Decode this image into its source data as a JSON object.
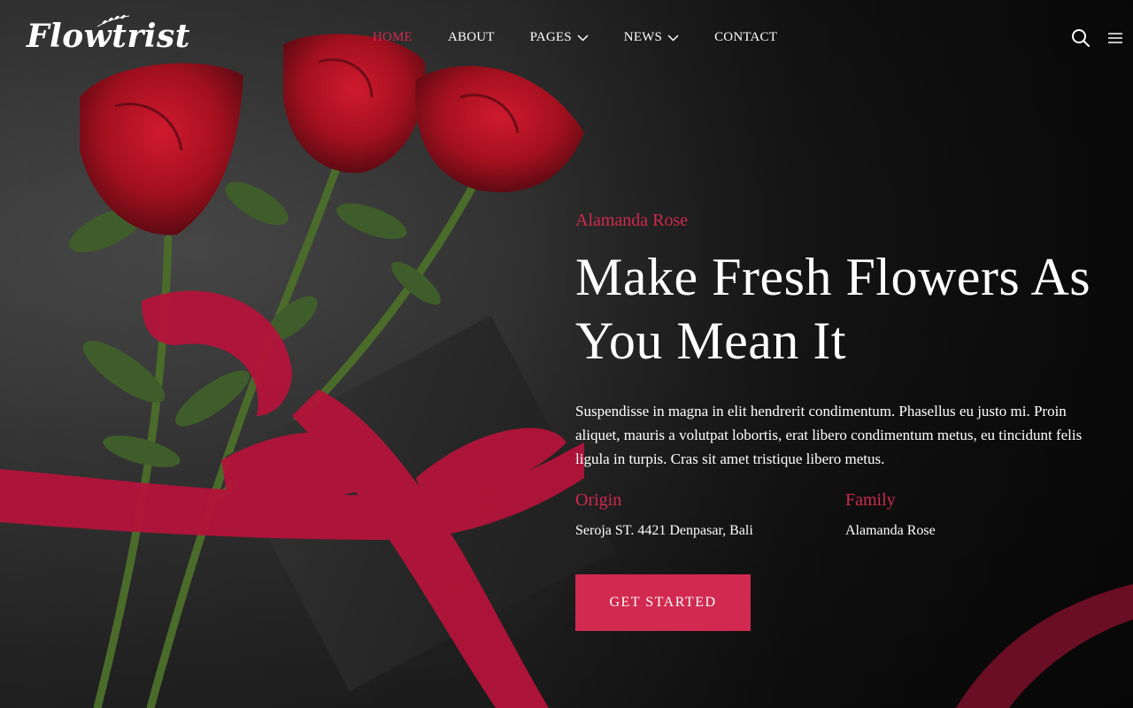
{
  "brand": {
    "logo_text": "Flowtrist"
  },
  "nav": {
    "items": [
      {
        "label": "HOME",
        "active": true,
        "has_dropdown": false
      },
      {
        "label": "ABOUT",
        "active": false,
        "has_dropdown": false
      },
      {
        "label": "PAGES",
        "active": false,
        "has_dropdown": true
      },
      {
        "label": "NEWS",
        "active": false,
        "has_dropdown": true
      },
      {
        "label": "CONTACT",
        "active": false,
        "has_dropdown": false
      }
    ]
  },
  "header_icons": [
    "search-icon",
    "hamburger-menu-icon"
  ],
  "hero": {
    "eyebrow": "Alamanda Rose",
    "title_line1": "Make Fresh Flowers As",
    "title_line2": "You Mean It",
    "description": "Suspendisse in magna in elit hendrerit condimentum. Phasellus eu justo mi. Proin aliquet, mauris a volutpat lobortis, erat libero condimentum metus, eu tincidunt felis ligula in turpis. Cras sit amet tristique libero metus.",
    "origin_label": "Origin",
    "origin_value": "Seroja ST. 4421 Denpasar, Bali",
    "family_label": "Family",
    "family_value": "Alamanda Rose",
    "cta_label": "GET STARTED"
  },
  "colors": {
    "accent": "#d1294f",
    "background": "#1c1c1c",
    "text": "#ffffff"
  }
}
